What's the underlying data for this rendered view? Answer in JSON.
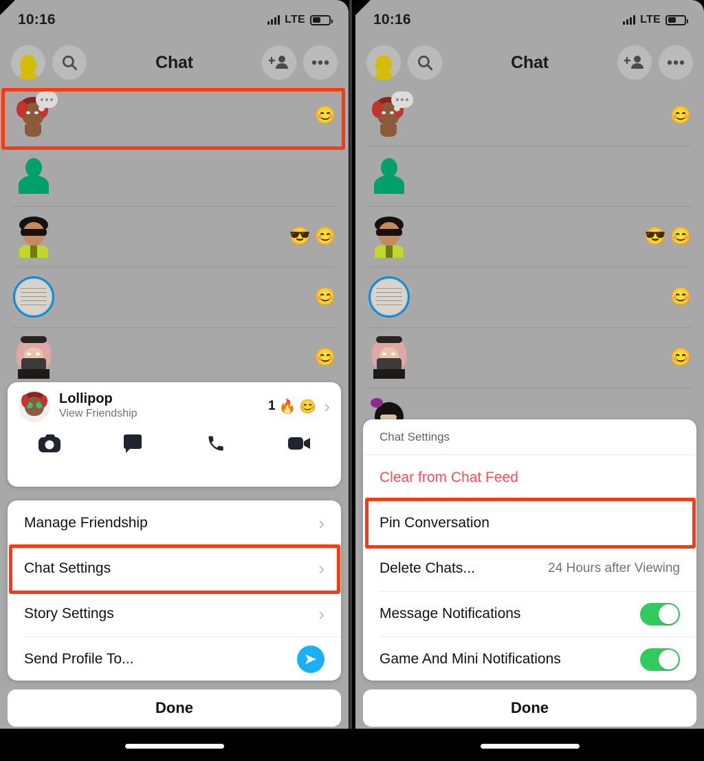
{
  "meta": {
    "accent_red": "#fb3a12",
    "toggle_green": "#2fcc5c",
    "danger_red": "#fb4c5c",
    "send_blue": "#19b0f5",
    "screen_bg": "#a8a8a8"
  },
  "status_bar": {
    "time": "10:16",
    "network_label": "LTE",
    "signal_icon": "signal-bars-icon",
    "battery_icon": "battery-icon"
  },
  "app_bar": {
    "title": "Chat",
    "profile_icon": "bitmoji-avatar-icon",
    "search_icon": "search-icon",
    "add_friend_icon": "add-friend-icon",
    "more_icon": "more-options-icon"
  },
  "chat_list": {
    "rows": [
      {
        "avatar": "bitmoji-red-hair-thinking-icon",
        "status_icon": "typing-bubble-icon",
        "emoji": [
          "😊"
        ]
      },
      {
        "avatar": "default-person-green-icon",
        "status_icon": "",
        "emoji": []
      },
      {
        "avatar": "bitmoji-sunglasses-icon",
        "status_icon": "",
        "emoji": [
          "😎",
          "😊"
        ]
      },
      {
        "avatar": "photo-story-ring-icon",
        "status_icon": "",
        "emoji": [
          "😊"
        ]
      },
      {
        "avatar": "bitmoji-keffiyeh-icon",
        "status_icon": "",
        "emoji": [
          "😊"
        ]
      },
      {
        "avatar": "bitmoji-purple-bow-icon",
        "status_icon": "",
        "emoji": []
      }
    ]
  },
  "left_panel": {
    "profile_card": {
      "avatar_icon": "bitmoji-money-eyes-icon",
      "name": "Lollipop",
      "subtitle": "View Friendship",
      "streak_count": "1",
      "streak_emoji": "🔥",
      "friend_emoji": "😊",
      "chevron_icon": "chevron-right-icon",
      "actions": [
        {
          "icon": "camera-icon"
        },
        {
          "icon": "chat-bubble-icon"
        },
        {
          "icon": "phone-call-icon"
        },
        {
          "icon": "video-call-icon"
        }
      ]
    },
    "menu": [
      {
        "label": "Manage Friendship",
        "trailing": "chevron-right-icon"
      },
      {
        "label": "Chat Settings",
        "trailing": "chevron-right-icon"
      },
      {
        "label": "Story Settings",
        "trailing": "chevron-right-icon"
      },
      {
        "label": "Send Profile To...",
        "trailing": "send-arrow-icon"
      }
    ],
    "done_label": "Done"
  },
  "right_panel": {
    "sheet_title": "Chat Settings",
    "menu": [
      {
        "label": "Clear from Chat Feed",
        "type": "danger",
        "value": ""
      },
      {
        "label": "Pin Conversation",
        "type": "plain",
        "value": ""
      },
      {
        "label": "Delete Chats...",
        "type": "value",
        "value": "24 Hours after Viewing"
      },
      {
        "label": "Message Notifications",
        "type": "toggle",
        "value": "on"
      },
      {
        "label": "Game And Mini Notifications",
        "type": "toggle",
        "value": "on"
      }
    ],
    "done_label": "Done"
  },
  "highlights": [
    {
      "name": "highlighted-chat-row",
      "panel": "left"
    },
    {
      "name": "highlighted-chat-settings-row",
      "panel": "left"
    },
    {
      "name": "highlighted-pin-conversation-row",
      "panel": "right"
    }
  ]
}
